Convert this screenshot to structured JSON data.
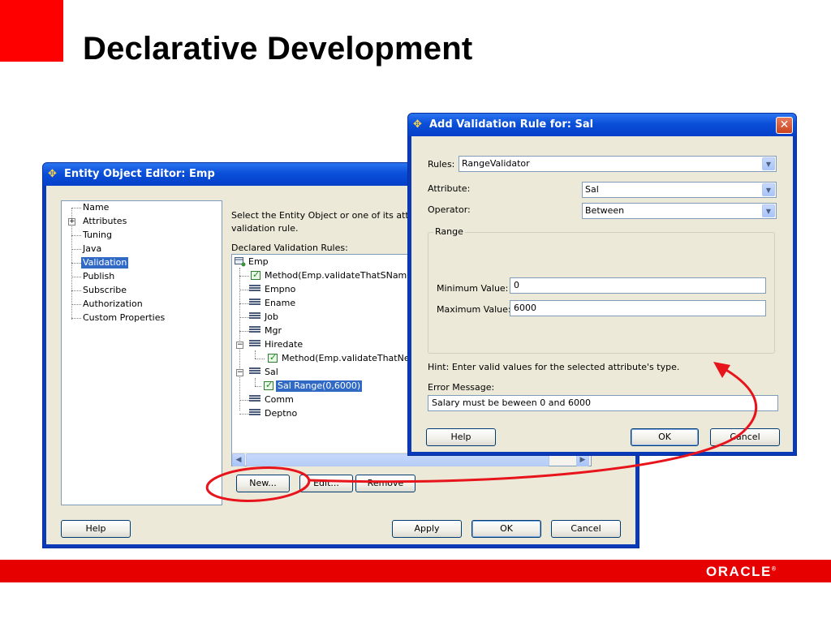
{
  "slide": {
    "title": "Declarative Development",
    "logo": "ORACLE"
  },
  "entity_editor": {
    "title": "Entity Object Editor: Emp",
    "nav": [
      "Name",
      "Attributes",
      "Tuning",
      "Java",
      "Validation",
      "Publish",
      "Subscribe",
      "Authorization",
      "Custom Properties"
    ],
    "selected_nav": "Validation",
    "instruction_line1": "Select the Entity Object or one of its attrib",
    "instruction_line2": "validation rule.",
    "rules_label": "Declared Validation Rules:",
    "tree": {
      "emp": "Emp",
      "method1": "Method(Emp.validateThatSNamesI",
      "empno": "Empno",
      "ename": "Ename",
      "job": "Job",
      "mgr": "Mgr",
      "hiredate": "Hiredate",
      "method2": "Method(Emp.validateThatNew",
      "sal": "Sal",
      "sal_range": "Sal Range(0,6000)",
      "comm": "Comm",
      "deptno": "Deptno"
    },
    "buttons": {
      "new": "New...",
      "edit": "Edit...",
      "remove": "Remove",
      "help": "Help",
      "apply": "Apply",
      "ok": "OK",
      "cancel": "Cancel"
    }
  },
  "validation_dialog": {
    "title": "Add Validation Rule for: Sal",
    "rules_label": "Rules:",
    "rules_value": "RangeValidator",
    "attribute_label": "Attribute:",
    "attribute_value": "Sal",
    "operator_label": "Operator:",
    "operator_value": "Between",
    "range_group": "Range",
    "min_label": "Minimum Value:",
    "min_value": "0",
    "max_label": "Maximum Value:",
    "max_value": "6000",
    "hint": "Hint: Enter valid values for the selected attribute's type.",
    "error_label": "Error Message:",
    "error_value": "Salary must be beween 0 and 6000",
    "buttons": {
      "help": "Help",
      "ok": "OK",
      "cancel": "Cancel"
    }
  },
  "colors": {
    "brand_red": "#e60000",
    "annotation_red": "#e8141c",
    "xp_blue": "#0a4fd8",
    "selection": "#316ac5"
  }
}
